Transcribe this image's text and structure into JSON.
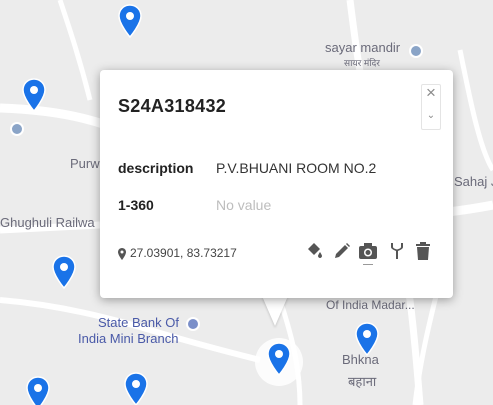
{
  "map": {
    "labels": {
      "sayar_mandir": "sayar mandir",
      "sayar_mandir_hindi": "सायर मंदिर",
      "purw": "Purw",
      "sahaj": "Sahaj J",
      "ghughuli_railway": "Ghughuli Railwa",
      "state_bank_line1": "State Bank Of",
      "state_bank_line2": "India Mini Branch",
      "union_bank": "Of India Madar...",
      "bahana": "Bhkna",
      "bahana_hindi": "बहाना"
    },
    "colors": {
      "pin": "#1a73e8",
      "background": "#ececec",
      "road": "#ffffff"
    }
  },
  "popup": {
    "title": "S24A318432",
    "close_icon": "close-icon",
    "fields": [
      {
        "label": "description",
        "value": "P.V.BHUANI ROOM NO.2"
      },
      {
        "label": "1-360",
        "value": "No value"
      }
    ],
    "coordinates": "27.03901, 83.73217",
    "tools": [
      "paint-bucket-icon",
      "pencil-icon",
      "camera-icon",
      "fork-icon",
      "trash-icon"
    ]
  }
}
